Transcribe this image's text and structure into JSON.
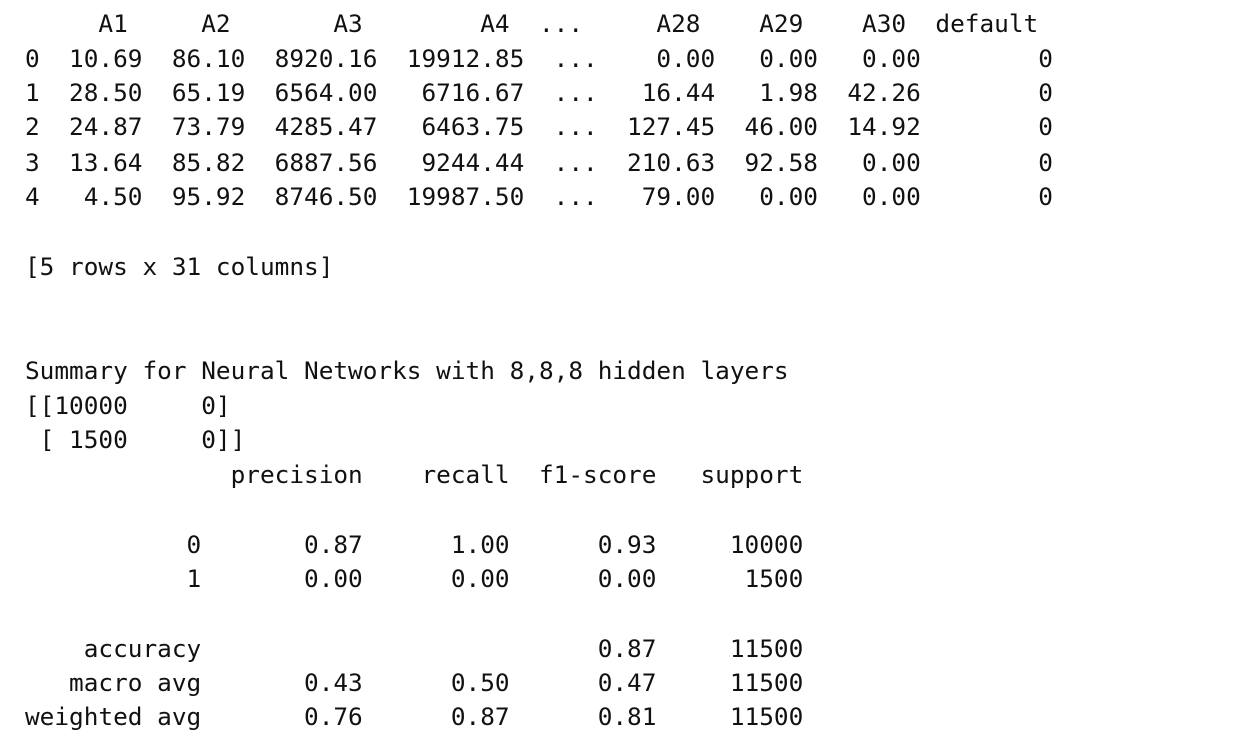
{
  "console_output": {
    "dataframe": {
      "header": "     A1     A2       A3        A4  ...     A28    A29    A30  default",
      "rows": [
        "0  10.69  86.10  8920.16  19912.85  ...    0.00   0.00   0.00        0",
        "1  28.50  65.19  6564.00   6716.67  ...   16.44   1.98  42.26        0",
        "2  24.87  73.79  4285.47   6463.75  ...  127.45  46.00  14.92        0",
        "3  13.64  85.82  6887.56   9244.44  ...  210.63  92.58   0.00        0",
        "4   4.50  95.92  8746.50  19987.50  ...   79.00   0.00   0.00        0"
      ],
      "shape_note": "[5 rows x 31 columns]"
    },
    "summary_title": "Summary for Neural Networks with 8,8,8 hidden layers",
    "confusion_matrix": [
      "[[10000     0]",
      " [ 1500     0]]"
    ],
    "classification_report": {
      "header": "              precision    recall  f1-score   support",
      "class_rows": [
        "           0       0.87      1.00      0.93     10000",
        "           1       0.00      0.00      0.00      1500"
      ],
      "summary_rows": [
        "    accuracy                           0.87     11500",
        "   macro avg       0.43      0.50      0.47     11500",
        "weighted avg       0.76      0.87      0.81     11500"
      ]
    }
  }
}
